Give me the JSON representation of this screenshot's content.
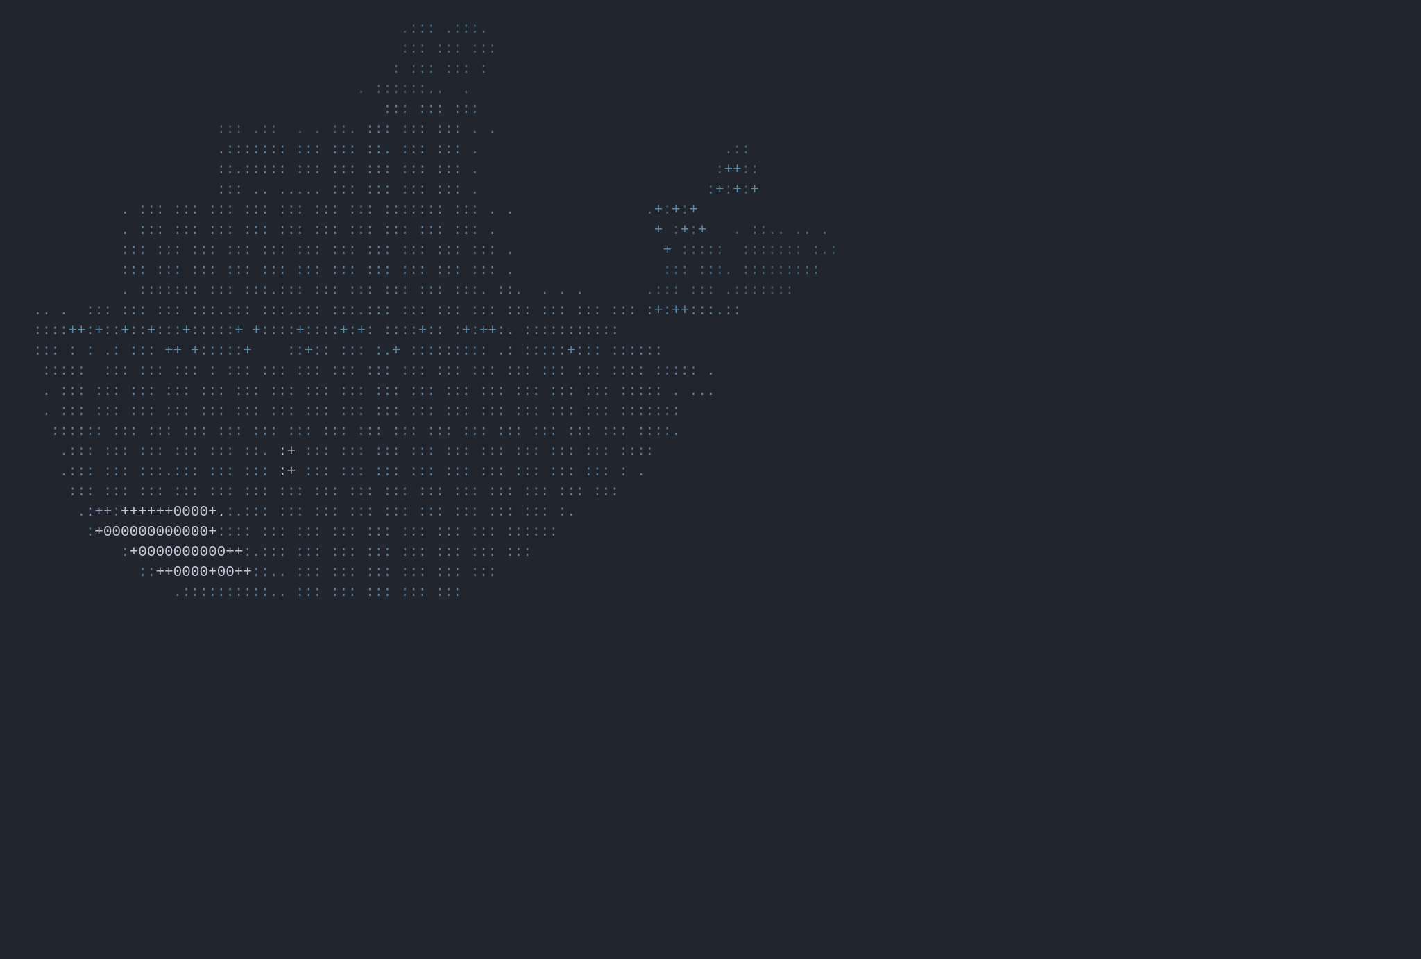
{
  "ascii": {
    "description": "docker-whale-ascii-art",
    "lines": [
      {
        "pre": "                                          ",
        "runs": [
          {
            "t": ".::: .:::.",
            "c": "d"
          }
        ]
      },
      {
        "pre": "                                          ",
        "runs": [
          {
            "t": "::: ::: :::",
            "c": "d"
          }
        ]
      },
      {
        "pre": "                                         ",
        "runs": [
          {
            "t": ": ::: ::: :",
            "c": "d"
          }
        ]
      },
      {
        "pre": "                                     ",
        "runs": [
          {
            "t": ". ::::::..  .",
            "c": "d"
          }
        ]
      },
      {
        "pre": "                                        ",
        "runs": [
          {
            "t": "::: ::: :::",
            "c": "g"
          }
        ]
      },
      {
        "pre": "                     ",
        "runs": [
          {
            "t": "::: .::  . . ::.",
            "c": "d"
          },
          {
            "t": " ::: ::: ::: . .",
            "c": "g"
          }
        ]
      },
      {
        "pre": "                     ",
        "runs": [
          {
            "t": ".::::::: ::: ::: ::. ::: ::: .",
            "c": "g"
          },
          {
            "t": "                            .::",
            "c": "d"
          }
        ]
      },
      {
        "pre": "                     ",
        "runs": [
          {
            "t": "::.::::: ::: ::: ::: ::: ::: .",
            "c": "g"
          },
          {
            "t": "                           :",
            "c": "d"
          },
          {
            "t": "++",
            "c": "b"
          },
          {
            "t": "::",
            "c": "d"
          }
        ]
      },
      {
        "pre": "                     ",
        "runs": [
          {
            "t": "::: .. ..... ::: ::: ::: ::: .",
            "c": "g"
          },
          {
            "t": "                          :",
            "c": "d"
          },
          {
            "t": "+",
            "c": "b"
          },
          {
            "t": ":",
            "c": "d"
          },
          {
            "t": "+",
            "c": "b"
          },
          {
            "t": ":",
            "c": "d"
          },
          {
            "t": "+",
            "c": "b"
          }
        ]
      },
      {
        "pre": "          ",
        "runs": [
          {
            "t": ". ::: ::: ::: ::: ::: ::: ::: ::::::: ::: . .",
            "c": "g"
          },
          {
            "t": "               .",
            "c": "d"
          },
          {
            "t": "+",
            "c": "b"
          },
          {
            "t": ":",
            "c": "d"
          },
          {
            "t": "+",
            "c": "b"
          },
          {
            "t": ":",
            "c": "d"
          },
          {
            "t": "+",
            "c": "b"
          }
        ]
      },
      {
        "pre": "          ",
        "runs": [
          {
            "t": ". ::: ::: ::: ::: ::: ::: ::: ::: ::: ::: .",
            "c": "g"
          },
          {
            "t": "                  ",
            "c": "d"
          },
          {
            "t": "+ ",
            "c": "b"
          },
          {
            "t": ":",
            "c": "d"
          },
          {
            "t": "+",
            "c": "b"
          },
          {
            "t": ":",
            "c": "d"
          },
          {
            "t": "+ ",
            "c": "b"
          },
          {
            "t": "  . ::.. .. .",
            "c": "d"
          }
        ]
      },
      {
        "pre": "          ",
        "runs": [
          {
            "t": "::: ::: ::: ::: ::: ::: ::: ::: ::: ::: ::: .",
            "c": "g"
          },
          {
            "t": "                 ",
            "c": "d"
          },
          {
            "t": "+ ",
            "c": "b"
          },
          {
            "t": ":::::  ::::::: :.:",
            "c": "d"
          }
        ]
      },
      {
        "pre": "          ",
        "runs": [
          {
            "t": "::: ::: ::: ::: ::: ::: ::: ::: ::: ::: ::: .",
            "c": "g"
          },
          {
            "t": "                 ::: :::. :::::::::",
            "c": "d"
          }
        ]
      },
      {
        "pre": "          ",
        "runs": [
          {
            "t": ". ::::::: ::: :::.::: ::: ::: ::: ::: :::. ::.  . . .",
            "c": "g"
          },
          {
            "t": "       .::: ::: .:::::::",
            "c": "d"
          }
        ]
      },
      {
        "pre": "",
        "runs": [
          {
            "t": ".. .  ::: ::: ::: :::.::: :::.::: :::.::: ::: ::: ::: ::: ::: ::: ::: :",
            "c": "g"
          },
          {
            "t": "+",
            "c": "b"
          },
          {
            "t": ":",
            "c": "g"
          },
          {
            "t": "++",
            "c": "b"
          },
          {
            "t": ":::.::",
            "c": "g"
          }
        ]
      },
      {
        "pre": "",
        "runs": [
          {
            "t": "::::",
            "c": "g"
          },
          {
            "t": "++",
            "c": "b"
          },
          {
            "t": ":",
            "c": "g"
          },
          {
            "t": "+",
            "c": "b"
          },
          {
            "t": "::",
            "c": "g"
          },
          {
            "t": "+",
            "c": "b"
          },
          {
            "t": "::",
            "c": "g"
          },
          {
            "t": "+",
            "c": "b"
          },
          {
            "t": ":::",
            "c": "g"
          },
          {
            "t": "+",
            "c": "b"
          },
          {
            "t": ":::::",
            "c": "g"
          },
          {
            "t": "+",
            "c": "b"
          },
          {
            "t": " ",
            "c": "g"
          },
          {
            "t": "+",
            "c": "b"
          },
          {
            "t": "::::",
            "c": "g"
          },
          {
            "t": "+",
            "c": "b"
          },
          {
            "t": "::::",
            "c": "g"
          },
          {
            "t": "+",
            "c": "b"
          },
          {
            "t": ":",
            "c": "g"
          },
          {
            "t": "+",
            "c": "b"
          },
          {
            "t": ": ::::",
            "c": "g"
          },
          {
            "t": "+",
            "c": "b"
          },
          {
            "t": ":: :",
            "c": "g"
          },
          {
            "t": "+",
            "c": "b"
          },
          {
            "t": ":",
            "c": "g"
          },
          {
            "t": "++",
            "c": "b"
          },
          {
            "t": ":. :::::::::::",
            "c": "g"
          }
        ]
      },
      {
        "pre": "",
        "runs": [
          {
            "t": "::: : : .: :::",
            "c": "g"
          },
          {
            "t": " ++ +",
            "c": "b"
          },
          {
            "t": ":::::",
            "c": "g"
          },
          {
            "t": "+",
            "c": "b"
          },
          {
            "t": "    ::",
            "c": "g"
          },
          {
            "t": "+",
            "c": "b"
          },
          {
            "t": ":: ::: :.",
            "c": "g"
          },
          {
            "t": "+",
            "c": "b"
          },
          {
            "t": " ::::::::: .: :::::",
            "c": "g"
          },
          {
            "t": "+",
            "c": "b"
          },
          {
            "t": "::: ::::::",
            "c": "g"
          }
        ]
      },
      {
        "pre": " ",
        "runs": [
          {
            "t": ":::::  ::: ::: ::: : ::: ::: ::: ::: ::: ::: ::: ::: ::: ::: ::: :::: ::::: .",
            "c": "g"
          }
        ]
      },
      {
        "pre": " ",
        "runs": [
          {
            "t": ". ::: ::: ::: ::: ::: ::: ::: ::: ::: ::: ::: ::: ::: ::: ::: ::: ::::: . ...",
            "c": "g"
          }
        ]
      },
      {
        "pre": " ",
        "runs": [
          {
            "t": ". ::: ::: ::: ::: ::: ::: ::: ::: ::: ::: ::: ::: ::: ::: ::: ::: :::::::",
            "c": "g"
          }
        ]
      },
      {
        "pre": "  ",
        "runs": [
          {
            "t": ":::::: ::: ::: ::: ::: ::: ::: ::: ::: ::: ::: ::: ::: ::: ::: ::: ::::.",
            "c": "g"
          }
        ]
      },
      {
        "pre": "   ",
        "runs": [
          {
            "t": ".::: ::: ::: ::: ::: ::. ",
            "c": "g"
          },
          {
            "t": ":+ ",
            "c": "w"
          },
          {
            "t": "::: ::: ::: ::: ::: ::: ::: ::: ::: ::::",
            "c": "g"
          }
        ]
      },
      {
        "pre": "   ",
        "runs": [
          {
            "t": ".::: ::: :::.::: ::: ::: ",
            "c": "g"
          },
          {
            "t": ":+ ",
            "c": "w"
          },
          {
            "t": "::: ::: ::: ::: ::: ::: ::: ::: ::: : .",
            "c": "g"
          }
        ]
      },
      {
        "pre": "    ",
        "runs": [
          {
            "t": "::: ::: ::: ::: ::: ::: ::: ::: ::: ::: ::: ::: ::: ::: ::: :::",
            "c": "g"
          }
        ]
      },
      {
        "pre": "     ",
        "runs": [
          {
            "t": ".",
            "c": "g"
          },
          {
            "t": ":++",
            "c": "p"
          },
          {
            "t": ":",
            "c": "g"
          },
          {
            "t": "++++++",
            "c": "w"
          },
          {
            "t": "0000",
            "c": "w"
          },
          {
            "t": "+.",
            "c": "w"
          },
          {
            "t": ":.::: ::: ::: ::: ::: ::: ::: ::: ::: :.",
            "c": "g"
          }
        ]
      },
      {
        "pre": "      ",
        "runs": [
          {
            "t": ":",
            "c": "g"
          },
          {
            "t": "+",
            "c": "w"
          },
          {
            "t": "000000000000",
            "c": "w"
          },
          {
            "t": "+",
            "c": "w"
          },
          {
            "t": ":::: ::: ::: ::: ::: ::: ::: ::: ::::::",
            "c": "g"
          }
        ]
      },
      {
        "pre": "          ",
        "runs": [
          {
            "t": ":",
            "c": "g"
          },
          {
            "t": "+",
            "c": "w"
          },
          {
            "t": "0000000000",
            "c": "w"
          },
          {
            "t": "++",
            "c": "w"
          },
          {
            "t": ":.::: ::: ::: ::: ::: ::: ::: :::",
            "c": "g"
          }
        ]
      },
      {
        "pre": "            ",
        "runs": [
          {
            "t": "::",
            "c": "g"
          },
          {
            "t": "++",
            "c": "w"
          },
          {
            "t": "0000",
            "c": "w"
          },
          {
            "t": "+",
            "c": "w"
          },
          {
            "t": "00",
            "c": "w"
          },
          {
            "t": "++",
            "c": "w"
          },
          {
            "t": "::.. ::: ::: ::: ::: ::: :::",
            "c": "g"
          }
        ]
      },
      {
        "pre": "                ",
        "runs": [
          {
            "t": ".::::::::::.. ::: ::: ::: ::: :::",
            "c": "g"
          }
        ]
      }
    ]
  }
}
